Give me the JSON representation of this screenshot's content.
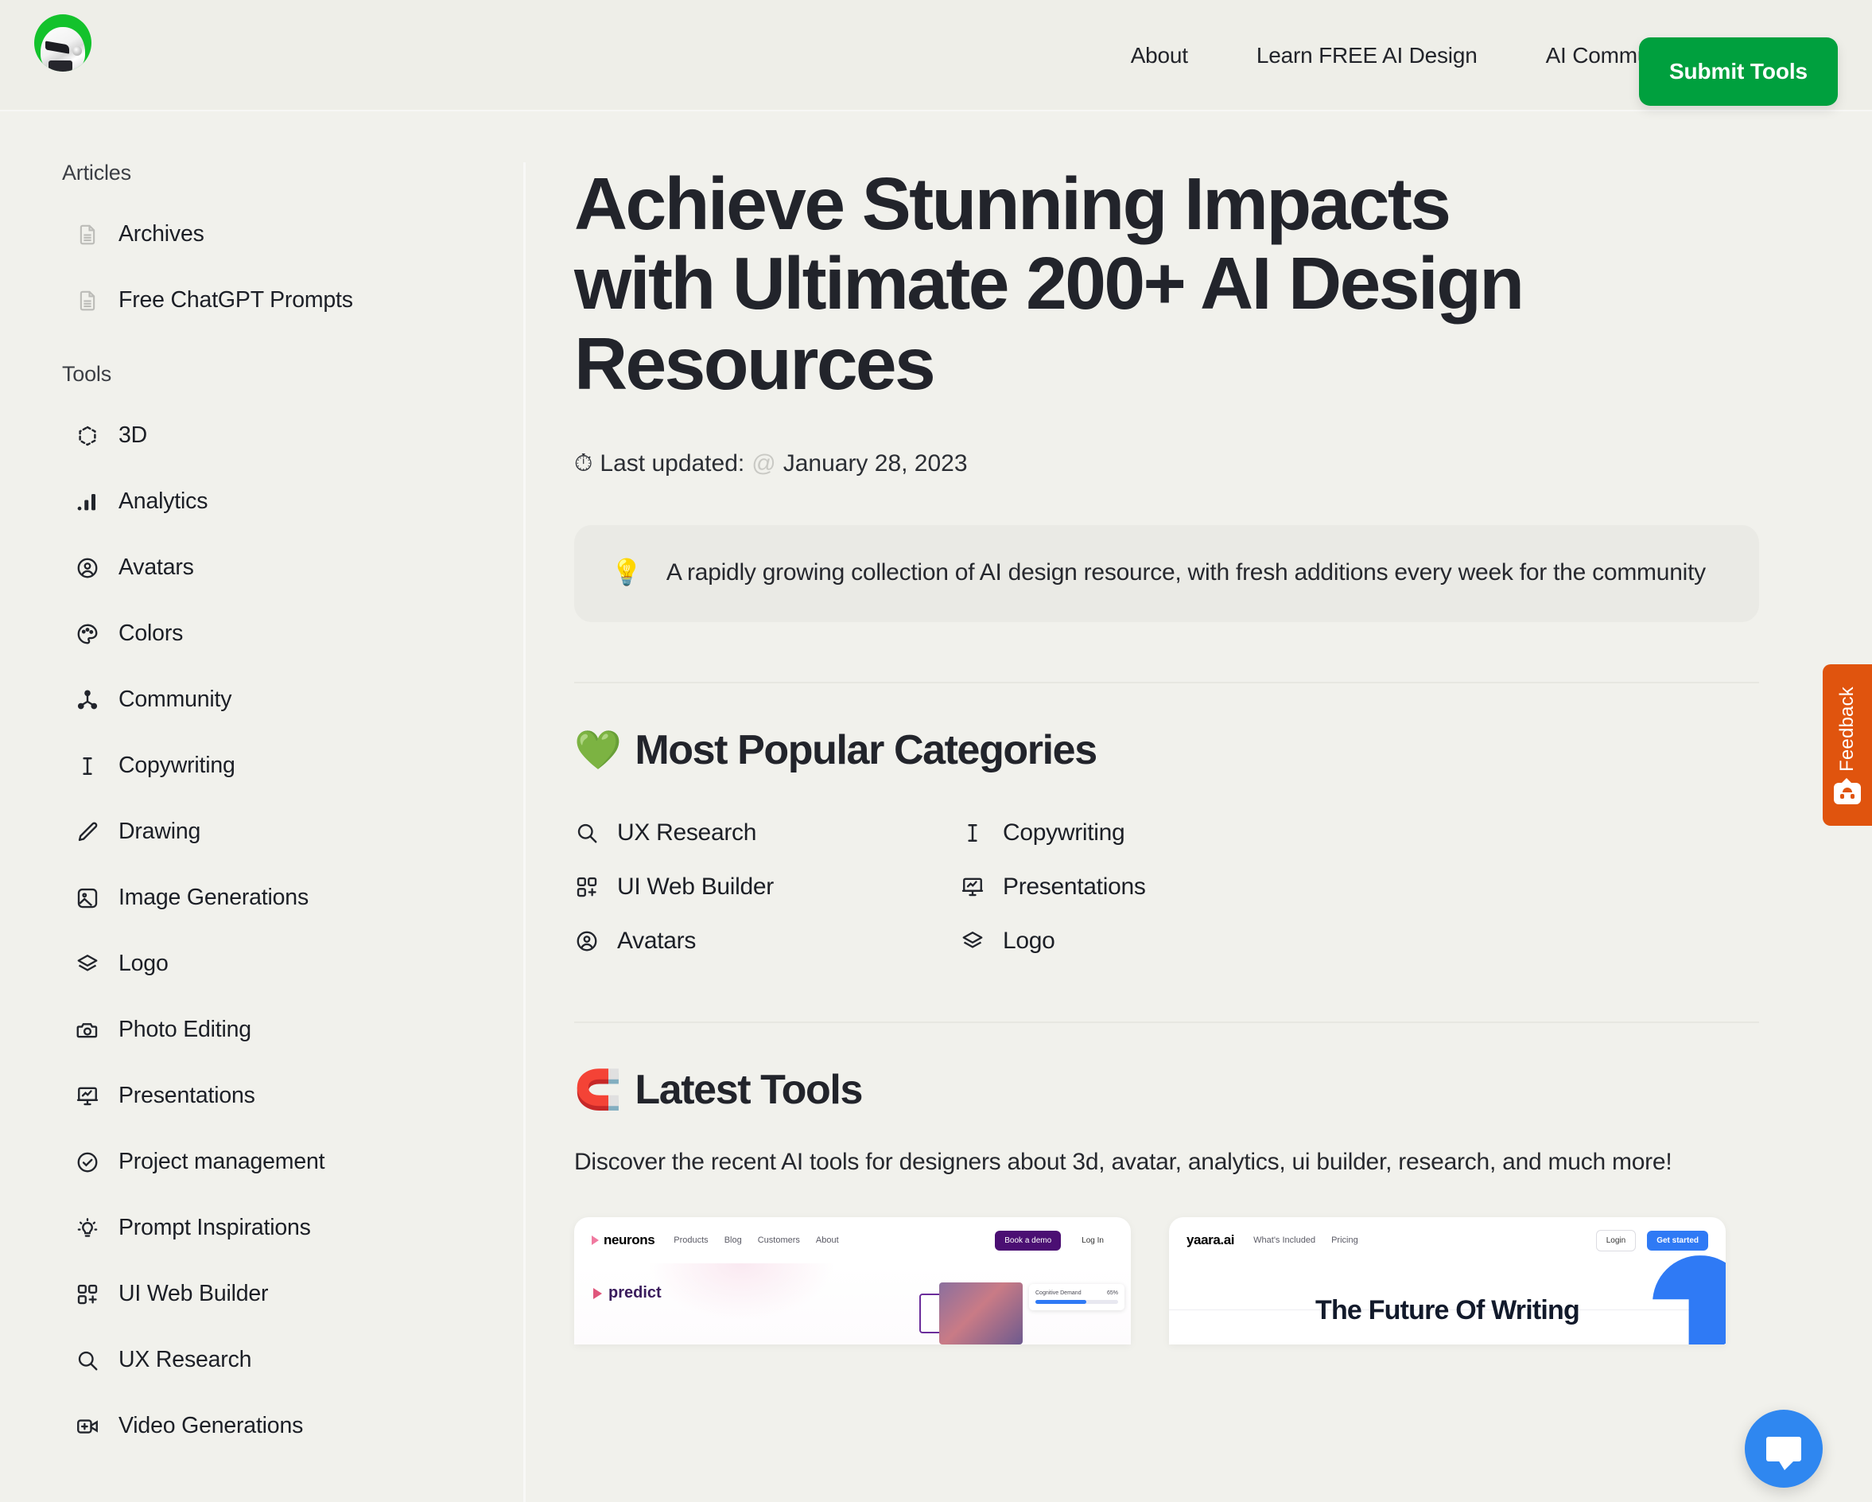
{
  "header": {
    "logo_name": "ai-design-logo",
    "nav": [
      {
        "label": "About"
      },
      {
        "label": "Learn FREE AI Design"
      },
      {
        "label": "AI Community"
      }
    ],
    "submit_label": "Submit Tools",
    "submit_color": "#00a03e"
  },
  "sidebar": {
    "groups": [
      {
        "title": "Articles",
        "items": [
          {
            "label": "Archives",
            "icon": "document-icon"
          },
          {
            "label": "Free ChatGPT Prompts",
            "icon": "document-icon"
          }
        ]
      },
      {
        "title": "Tools",
        "items": [
          {
            "label": "3D",
            "icon": "cube-3d-icon"
          },
          {
            "label": "Analytics",
            "icon": "bar-chart-icon"
          },
          {
            "label": "Avatars",
            "icon": "user-circle-icon"
          },
          {
            "label": "Colors",
            "icon": "palette-icon"
          },
          {
            "label": "Community",
            "icon": "network-icon"
          },
          {
            "label": "Copywriting",
            "icon": "text-cursor-icon"
          },
          {
            "label": "Drawing",
            "icon": "pencil-icon"
          },
          {
            "label": "Image Generations",
            "icon": "image-icon"
          },
          {
            "label": "Logo",
            "icon": "layers-icon"
          },
          {
            "label": "Photo Editing",
            "icon": "camera-icon"
          },
          {
            "label": "Presentations",
            "icon": "presentation-icon"
          },
          {
            "label": "Project management",
            "icon": "check-circle-icon"
          },
          {
            "label": "Prompt Inspirations",
            "icon": "lightbulb-icon"
          },
          {
            "label": "UI Web Builder",
            "icon": "grid-plus-icon"
          },
          {
            "label": "UX Research",
            "icon": "search-icon"
          },
          {
            "label": "Video Generations",
            "icon": "video-plus-icon"
          }
        ]
      }
    ]
  },
  "main": {
    "title": "Achieve Stunning Impacts with Ultimate 200+ AI Design Resources",
    "last_updated_label": "Last updated:",
    "last_updated_at": "@",
    "last_updated_date": "January 28, 2023",
    "last_updated_icon": "⏱",
    "callout": {
      "icon": "💡",
      "text": "A rapidly growing collection of AI design resource, with fresh additions every week for the community"
    },
    "popular": {
      "emoji": "💚",
      "heading": "Most Popular Categories",
      "items": [
        {
          "label": "UX Research",
          "icon": "search-icon"
        },
        {
          "label": "Copywriting",
          "icon": "text-cursor-icon"
        },
        {
          "label": "UI Web Builder",
          "icon": "grid-plus-icon"
        },
        {
          "label": "Presentations",
          "icon": "presentation-icon"
        },
        {
          "label": "Avatars",
          "icon": "user-circle-icon"
        },
        {
          "label": "Logo",
          "icon": "layers-icon"
        }
      ]
    },
    "latest": {
      "emoji": "🧲",
      "heading": "Latest Tools",
      "description": "Discover the recent AI tools for designers about 3d, avatar, analytics, ui builder, research, and much more!",
      "cards": [
        {
          "brand": "neurons",
          "links": [
            "Products",
            "Blog",
            "Customers",
            "About"
          ],
          "cta": "Book a demo",
          "secondary": "Log In",
          "tagline": "predict",
          "metric_label": "Cognitive Demand",
          "metric_value": "65%"
        },
        {
          "brand": "yaara.ai",
          "links": [
            "What's Included",
            "Pricing"
          ],
          "cta": "Get started",
          "secondary": "Login",
          "tagline": "The Future Of Writing"
        }
      ]
    }
  },
  "widgets": {
    "feedback_label": "Feedback",
    "feedback_color": "#e0540e",
    "chat_color": "#2f87f0"
  }
}
